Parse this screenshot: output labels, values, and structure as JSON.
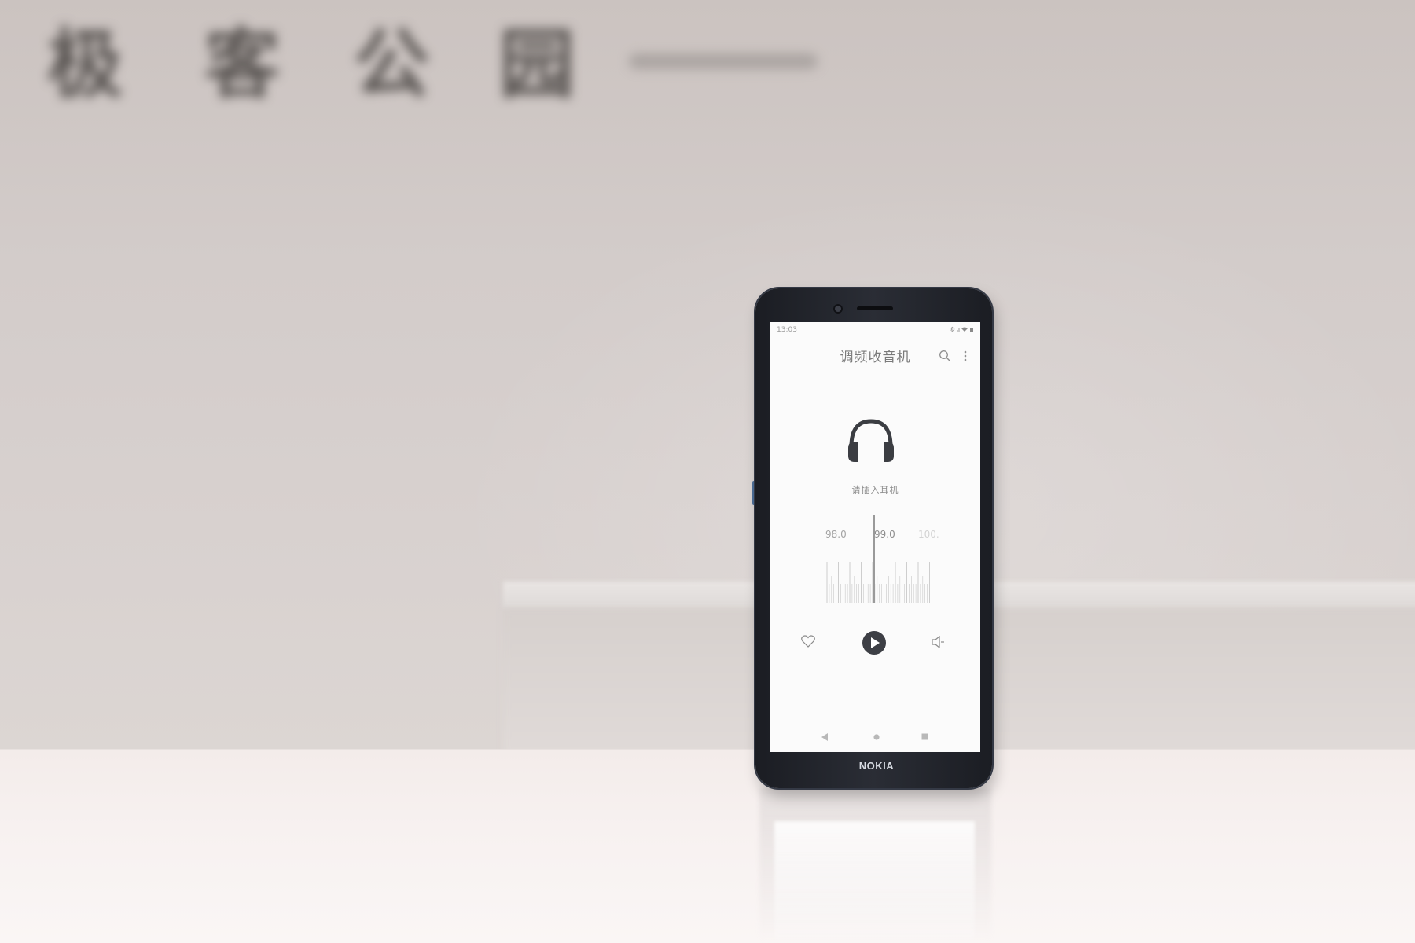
{
  "background_sign": {
    "chars": [
      "极",
      "客",
      "公",
      "园"
    ]
  },
  "phone": {
    "brand": "NOKIA",
    "status_bar": {
      "time": "13:03"
    },
    "app": {
      "title": "调频收音机",
      "hint": "请插入耳机",
      "frequencies": [
        "98.0",
        "99.0",
        "100."
      ],
      "icons": {
        "search": "search-icon",
        "menu": "more-vertical-icon",
        "headphones": "headphones-icon",
        "favorite": "heart-icon",
        "play": "play-icon",
        "speaker": "speaker-icon"
      }
    },
    "nav_bar": {
      "icons": [
        "back-icon",
        "home-icon",
        "recents-icon"
      ]
    }
  }
}
